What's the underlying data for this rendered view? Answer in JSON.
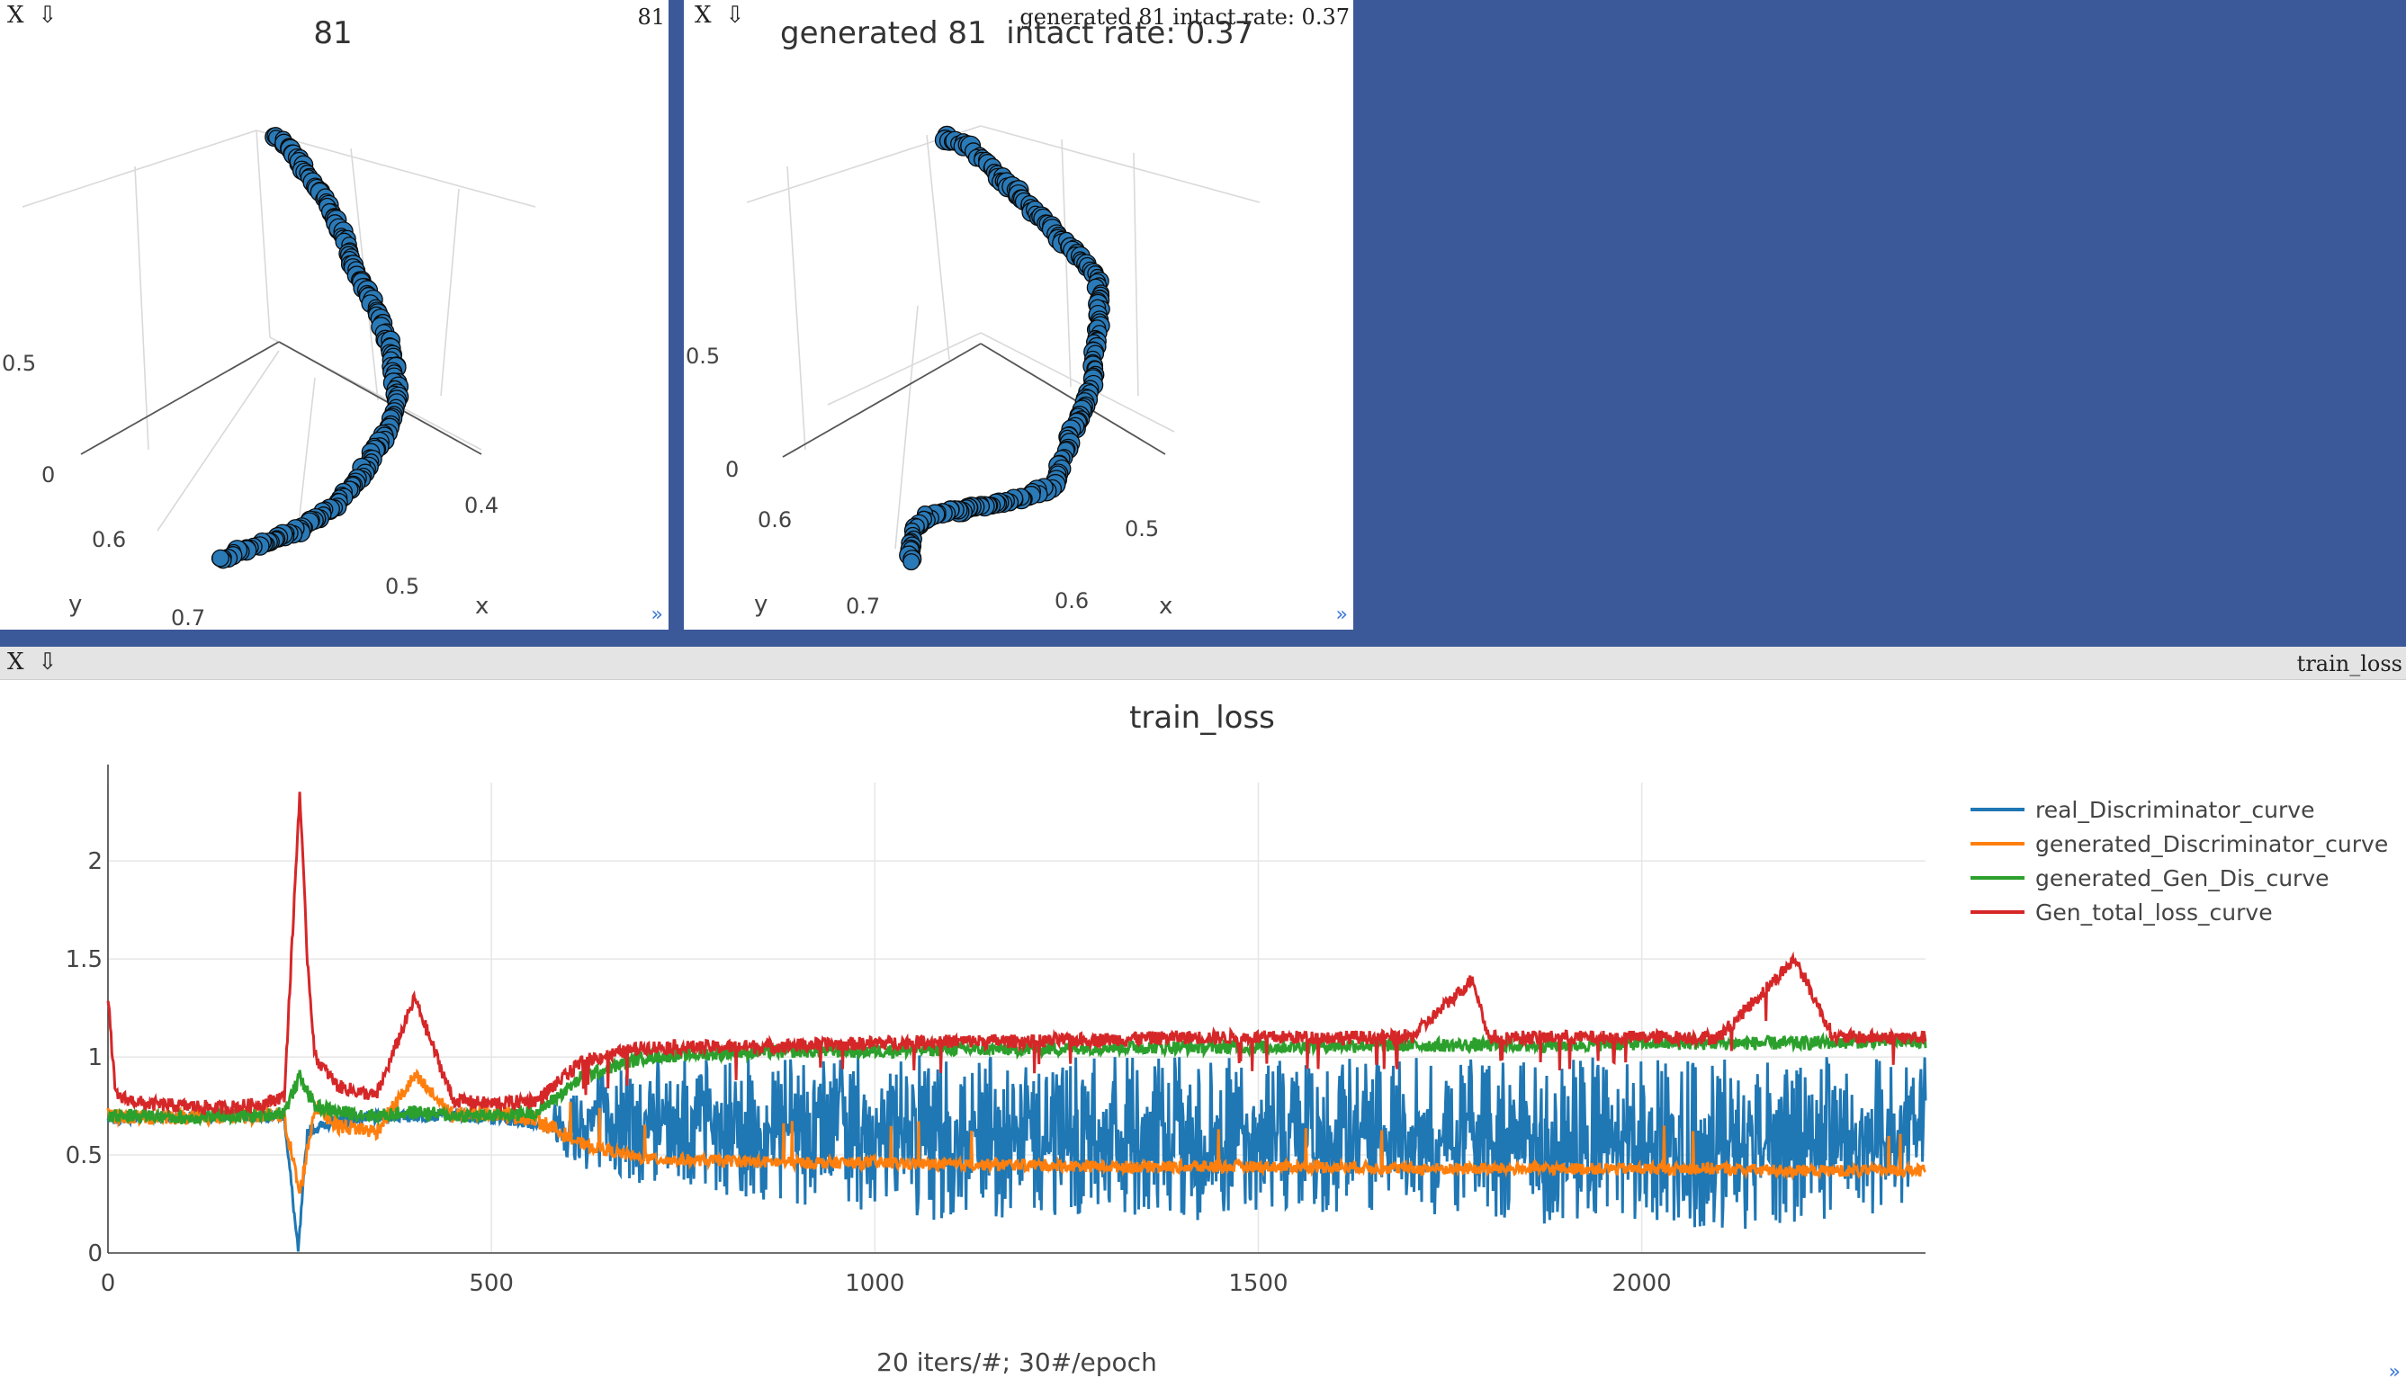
{
  "colors": {
    "background": "#3b5998",
    "scatter_fill": "#2a7ab8",
    "scatter_edge": "#0a0a0a",
    "real_d": "#1f77b4",
    "gen_d": "#ff7f0e",
    "gen_gd": "#2ca02c",
    "gen_total": "#d62728"
  },
  "controls": {
    "close": "X",
    "pin": "⇩",
    "resize": "»"
  },
  "pane1": {
    "window_title": "81",
    "plot_title": "81",
    "z_ticks": [
      "0.5",
      "0"
    ],
    "y_ticks": [
      "0.6",
      "0.7"
    ],
    "x_ticks": [
      "0.4",
      "0.5"
    ],
    "y_label": "y",
    "x_label": "x"
  },
  "pane2": {
    "window_title": "generated 81 intact rate: 0.37",
    "plot_title": "generated 81  intact rate: 0.37",
    "z_ticks": [
      "0.5",
      "0"
    ],
    "y_ticks": [
      "0.6",
      "0.7"
    ],
    "x_ticks": [
      "0.5",
      "0.6"
    ],
    "y_label": "y",
    "x_label": "x"
  },
  "pane3": {
    "window_title": "train_loss",
    "plot_title": "train_loss",
    "x_label": "20 iters/#; 30#/epoch",
    "legend_position": "top-right"
  },
  "chart_data": {
    "type": "line",
    "title": "train_loss",
    "xlabel": "20 iters/#; 30#/epoch",
    "ylabel": "",
    "xlim": [
      0,
      2370
    ],
    "ylim": [
      0,
      2.4
    ],
    "x_ticks": [
      0,
      500,
      1000,
      1500,
      2000
    ],
    "y_ticks": [
      0,
      0.5,
      1,
      1.5,
      2
    ],
    "grid": true,
    "series": [
      {
        "name": "real_Discriminator_curve",
        "color": "#1f77b4",
        "x": [
          0,
          50,
          100,
          150,
          200,
          230,
          248,
          260,
          300,
          350,
          400,
          450,
          500,
          560,
          600,
          650,
          700,
          800,
          900,
          1000,
          1100,
          1200,
          1300,
          1400,
          1500,
          1600,
          1700,
          1800,
          1900,
          2000,
          2100,
          2200,
          2300,
          2370
        ],
        "y": [
          0.68,
          0.7,
          0.69,
          0.7,
          0.7,
          0.7,
          0.0,
          0.62,
          0.68,
          0.69,
          0.7,
          0.7,
          0.69,
          0.66,
          0.6,
          0.6,
          0.6,
          0.6,
          0.6,
          0.6,
          0.6,
          0.6,
          0.6,
          0.6,
          0.6,
          0.6,
          0.6,
          0.6,
          0.6,
          0.6,
          0.6,
          0.6,
          0.6,
          0.6
        ],
        "band_to": [
          0.68,
          0.7,
          0.69,
          0.7,
          0.7,
          0.7,
          0.0,
          0.62,
          0.68,
          0.69,
          0.7,
          0.7,
          0.69,
          0.66,
          0.35,
          0.3,
          0.25,
          0.2,
          0.15,
          0.1,
          0.05,
          0.08,
          0.1,
          0.05,
          0.1,
          0.1,
          0.1,
          0.05,
          0.05,
          0.05,
          0.0,
          0.05,
          0.1,
          0.2
        ],
        "band_from": [
          0.68,
          0.7,
          0.69,
          0.7,
          0.7,
          0.7,
          0.0,
          0.62,
          0.68,
          0.69,
          0.7,
          0.7,
          0.69,
          0.66,
          0.85,
          0.95,
          1.0,
          1.0,
          1.0,
          1.02,
          1.0,
          1.0,
          1.0,
          1.0,
          1.0,
          1.0,
          1.0,
          1.0,
          1.0,
          1.0,
          1.0,
          1.0,
          1.0,
          1.0
        ]
      },
      {
        "name": "generated_Discriminator_curve",
        "color": "#ff7f0e",
        "x": [
          0,
          50,
          100,
          150,
          200,
          230,
          250,
          270,
          300,
          350,
          400,
          450,
          500,
          560,
          620,
          700,
          800,
          900,
          1000,
          1100,
          1200,
          1300,
          1400,
          1500,
          1600,
          1700,
          1800,
          1900,
          2000,
          2100,
          2200,
          2300,
          2370
        ],
        "y": [
          0.7,
          0.69,
          0.7,
          0.69,
          0.7,
          0.69,
          0.3,
          0.75,
          0.65,
          0.62,
          0.9,
          0.7,
          0.72,
          0.68,
          0.55,
          0.48,
          0.47,
          0.46,
          0.46,
          0.45,
          0.45,
          0.44,
          0.44,
          0.44,
          0.44,
          0.43,
          0.43,
          0.43,
          0.43,
          0.43,
          0.42,
          0.42,
          0.42
        ]
      },
      {
        "name": "generated_Gen_Dis_curve",
        "color": "#2ca02c",
        "x": [
          0,
          50,
          100,
          150,
          200,
          230,
          250,
          270,
          300,
          350,
          400,
          450,
          500,
          560,
          620,
          700,
          800,
          900,
          1000,
          1100,
          1200,
          1300,
          1400,
          1500,
          1600,
          1700,
          1800,
          1900,
          2000,
          2100,
          2200,
          2300,
          2370
        ],
        "y": [
          0.7,
          0.7,
          0.69,
          0.7,
          0.7,
          0.72,
          0.9,
          0.75,
          0.72,
          0.7,
          0.72,
          0.7,
          0.7,
          0.72,
          0.9,
          1.0,
          1.02,
          1.03,
          1.03,
          1.04,
          1.04,
          1.05,
          1.05,
          1.05,
          1.06,
          1.06,
          1.06,
          1.06,
          1.07,
          1.07,
          1.07,
          1.08,
          1.08
        ]
      },
      {
        "name": "Gen_total_loss_curve",
        "color": "#d62728",
        "x": [
          0,
          10,
          50,
          100,
          150,
          200,
          230,
          250,
          260,
          270,
          300,
          350,
          400,
          450,
          500,
          560,
          620,
          700,
          800,
          900,
          1000,
          1100,
          1200,
          1300,
          1400,
          1500,
          1600,
          1700,
          1780,
          1800,
          1900,
          2000,
          2100,
          2200,
          2250,
          2300,
          2370
        ],
        "y": [
          1.3,
          0.8,
          0.76,
          0.75,
          0.74,
          0.76,
          0.8,
          2.35,
          1.5,
          1.0,
          0.85,
          0.8,
          1.3,
          0.78,
          0.76,
          0.78,
          0.98,
          1.05,
          1.05,
          1.06,
          1.07,
          1.08,
          1.08,
          1.09,
          1.1,
          1.1,
          1.1,
          1.1,
          1.4,
          1.1,
          1.1,
          1.1,
          1.1,
          1.5,
          1.1,
          1.1,
          1.1
        ]
      }
    ]
  }
}
